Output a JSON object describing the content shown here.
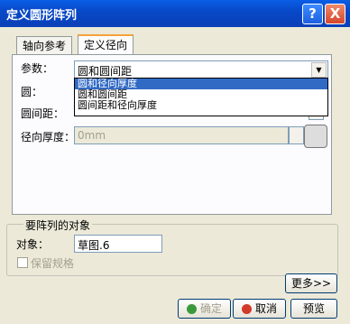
{
  "window": {
    "title": "定义圆形阵列",
    "help_icon": "?",
    "close_icon": "X"
  },
  "tabs": [
    {
      "label": "轴向参考"
    },
    {
      "label": "定义径向"
    }
  ],
  "form": {
    "param_label": "参数：",
    "param_value": "圆和圆间距",
    "circle_label": "圆：",
    "spacing_label": "圆间距：",
    "thickness_label": "径向厚度：",
    "thickness_value": "0mm"
  },
  "dropdown_options": [
    "圆和径向厚度",
    "圆和圆间距",
    "圆间距和径向厚度"
  ],
  "object_group": {
    "title": "要阵列的对象",
    "object_label": "对象：",
    "object_value": "草图.6",
    "keep_spec_label": "保留规格"
  },
  "buttons": {
    "more": "更多>>",
    "ok": "确定",
    "cancel": "取消",
    "preview": "预览"
  }
}
